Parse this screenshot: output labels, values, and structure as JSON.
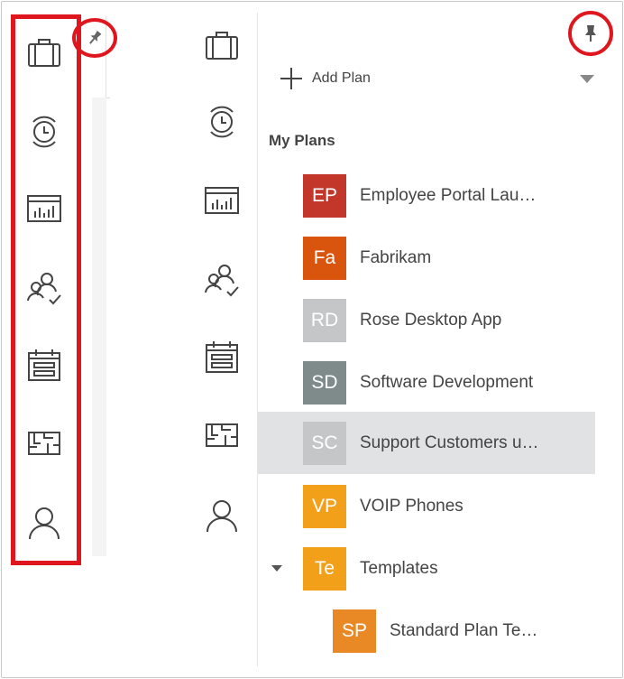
{
  "left_rail": {
    "items": [
      {
        "name": "plans-icon"
      },
      {
        "name": "timeline-icon"
      },
      {
        "name": "reports-icon"
      },
      {
        "name": "team-assignments-icon"
      },
      {
        "name": "calendar-icon"
      },
      {
        "name": "floorplan-icon"
      },
      {
        "name": "profile-icon"
      }
    ]
  },
  "add_plan": {
    "label": "Add Plan"
  },
  "my_plans": {
    "title": "My Plans",
    "plans": [
      {
        "initials": "EP",
        "label": "Employee Portal Lau…",
        "color": "#c3372a"
      },
      {
        "initials": "Fa",
        "label": "Fabrikam",
        "color": "#d9540c"
      },
      {
        "initials": "RD",
        "label": "Rose Desktop App",
        "color": "#c4c6c8"
      },
      {
        "initials": "SD",
        "label": "Software Development",
        "color": "#7e8b8a"
      },
      {
        "initials": "SC",
        "label": "Support Customers u…",
        "color": "#c4c6c8",
        "selected": true
      },
      {
        "initials": "VP",
        "label": "VOIP Phones",
        "color": "#f2a01a"
      },
      {
        "initials": "Te",
        "label": "Templates",
        "color": "#f2a01a",
        "expanded": true
      },
      {
        "initials": "SP",
        "label": "Standard Plan Te…",
        "color": "#e98925",
        "child": true
      }
    ]
  },
  "colors": {
    "highlight": "#e0161f",
    "selected_row": "#e1e2e4",
    "icon_stroke": "#444444"
  }
}
